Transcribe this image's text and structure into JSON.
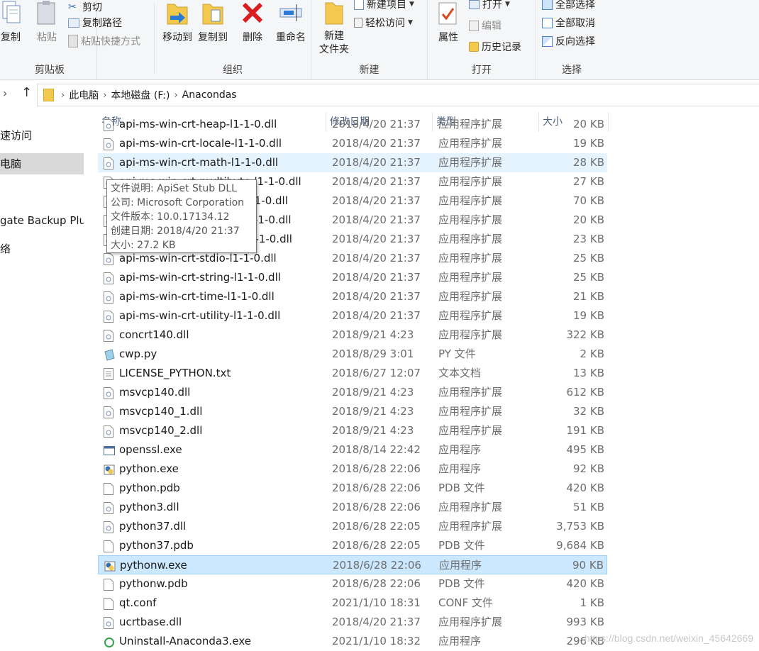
{
  "ribbon": {
    "clipboard": {
      "label": "剪贴板",
      "copy": "复制",
      "paste": "粘贴",
      "cut": "剪切",
      "copy_path": "复制路径",
      "paste_shortcut": "粘贴快捷方式"
    },
    "organize": {
      "label": "组织",
      "move_to": "移动到",
      "copy_to": "复制到",
      "delete": "删除",
      "rename": "重命名"
    },
    "new": {
      "label": "新建",
      "new_folder": "新建\n文件夹",
      "new_item": "新建项目",
      "easy_access": "轻松访问"
    },
    "open": {
      "label": "打开",
      "properties": "属性",
      "open": "打开",
      "edit": "编辑",
      "history": "历史记录"
    },
    "select": {
      "label": "选择",
      "select_all": "全部选择",
      "select_none": "全部取消",
      "invert": "反向选择"
    }
  },
  "address": {
    "crumbs": [
      "此电脑",
      "本地磁盘 (F:)",
      "Anacondas"
    ]
  },
  "nav": {
    "items": [
      "速访问",
      "电脑",
      "",
      "gate Backup Plu",
      "络"
    ]
  },
  "columns": {
    "name": "名称",
    "date": "修改日期",
    "type": "类型",
    "size": "大小"
  },
  "tooltip": {
    "lines": [
      "文件说明: ApiSet Stub DLL",
      "公司: Microsoft Corporation",
      "文件版本: 10.0.17134.12",
      "创建日期: 2018/4/20 21:37",
      "大小: 27.2 KB"
    ]
  },
  "files": [
    {
      "name": "api-ms-win-crt-heap-l1-1-0.dll",
      "date": "2018/4/20 21:37",
      "type": "应用程序扩展",
      "size": "20 KB",
      "icon": "dll"
    },
    {
      "name": "api-ms-win-crt-locale-l1-1-0.dll",
      "date": "2018/4/20 21:37",
      "type": "应用程序扩展",
      "size": "19 KB",
      "icon": "dll"
    },
    {
      "name": "api-ms-win-crt-math-l1-1-0.dll",
      "date": "2018/4/20 21:37",
      "type": "应用程序扩展",
      "size": "28 KB",
      "icon": "dll",
      "state": "hover"
    },
    {
      "name": "api-ms-win-crt-multibyte-l1-1-0.dll",
      "date": "2018/4/20 21:37",
      "type": "应用程序扩展",
      "size": "27 KB",
      "icon": "dll"
    },
    {
      "name": "api-ms-win-crt-private-l1-1-0.dll",
      "date": "2018/4/20 21:37",
      "type": "应用程序扩展",
      "size": "70 KB",
      "icon": "dll"
    },
    {
      "name": "api-ms-win-crt-process-l1-1-0.dll",
      "date": "2018/4/20 21:37",
      "type": "应用程序扩展",
      "size": "20 KB",
      "icon": "dll"
    },
    {
      "name": "api-ms-win-crt-runtime-l1-1-0.dll",
      "date": "2018/4/20 21:37",
      "type": "应用程序扩展",
      "size": "23 KB",
      "icon": "dll"
    },
    {
      "name": "api-ms-win-crt-stdio-l1-1-0.dll",
      "date": "2018/4/20 21:37",
      "type": "应用程序扩展",
      "size": "25 KB",
      "icon": "dll"
    },
    {
      "name": "api-ms-win-crt-string-l1-1-0.dll",
      "date": "2018/4/20 21:37",
      "type": "应用程序扩展",
      "size": "25 KB",
      "icon": "dll"
    },
    {
      "name": "api-ms-win-crt-time-l1-1-0.dll",
      "date": "2018/4/20 21:37",
      "type": "应用程序扩展",
      "size": "21 KB",
      "icon": "dll"
    },
    {
      "name": "api-ms-win-crt-utility-l1-1-0.dll",
      "date": "2018/4/20 21:37",
      "type": "应用程序扩展",
      "size": "19 KB",
      "icon": "dll"
    },
    {
      "name": "concrt140.dll",
      "date": "2018/9/21 4:23",
      "type": "应用程序扩展",
      "size": "322 KB",
      "icon": "dll"
    },
    {
      "name": "cwp.py",
      "date": "2018/8/29 3:01",
      "type": "PY 文件",
      "size": "2 KB",
      "icon": "py"
    },
    {
      "name": "LICENSE_PYTHON.txt",
      "date": "2018/6/27 12:07",
      "type": "文本文档",
      "size": "13 KB",
      "icon": "txt"
    },
    {
      "name": "msvcp140.dll",
      "date": "2018/9/21 4:23",
      "type": "应用程序扩展",
      "size": "612 KB",
      "icon": "dll"
    },
    {
      "name": "msvcp140_1.dll",
      "date": "2018/9/21 4:23",
      "type": "应用程序扩展",
      "size": "32 KB",
      "icon": "dll"
    },
    {
      "name": "msvcp140_2.dll",
      "date": "2018/9/21 4:23",
      "type": "应用程序扩展",
      "size": "191 KB",
      "icon": "dll"
    },
    {
      "name": "openssl.exe",
      "date": "2018/8/14 22:42",
      "type": "应用程序",
      "size": "495 KB",
      "icon": "exe"
    },
    {
      "name": "python.exe",
      "date": "2018/6/28 22:06",
      "type": "应用程序",
      "size": "92 KB",
      "icon": "python"
    },
    {
      "name": "python.pdb",
      "date": "2018/6/28 22:06",
      "type": "PDB 文件",
      "size": "420 KB",
      "icon": "blank"
    },
    {
      "name": "python3.dll",
      "date": "2018/6/28 22:06",
      "type": "应用程序扩展",
      "size": "51 KB",
      "icon": "dll"
    },
    {
      "name": "python37.dll",
      "date": "2018/6/28 22:05",
      "type": "应用程序扩展",
      "size": "3,753 KB",
      "icon": "dll"
    },
    {
      "name": "python37.pdb",
      "date": "2018/6/28 22:05",
      "type": "PDB 文件",
      "size": "9,684 KB",
      "icon": "blank"
    },
    {
      "name": "pythonw.exe",
      "date": "2018/6/28 22:06",
      "type": "应用程序",
      "size": "90 KB",
      "icon": "python",
      "state": "sel"
    },
    {
      "name": "pythonw.pdb",
      "date": "2018/6/28 22:06",
      "type": "PDB 文件",
      "size": "420 KB",
      "icon": "blank"
    },
    {
      "name": "qt.conf",
      "date": "2021/1/10 18:31",
      "type": "CONF 文件",
      "size": "1 KB",
      "icon": "blank"
    },
    {
      "name": "ucrtbase.dll",
      "date": "2018/4/20 21:37",
      "type": "应用程序扩展",
      "size": "993 KB",
      "icon": "dll"
    },
    {
      "name": "Uninstall-Anaconda3.exe",
      "date": "2021/1/10 18:32",
      "type": "应用程序",
      "size": "296 KB",
      "icon": "uninstall"
    }
  ],
  "watermark": "https://blog.csdn.net/weixin_45642669"
}
